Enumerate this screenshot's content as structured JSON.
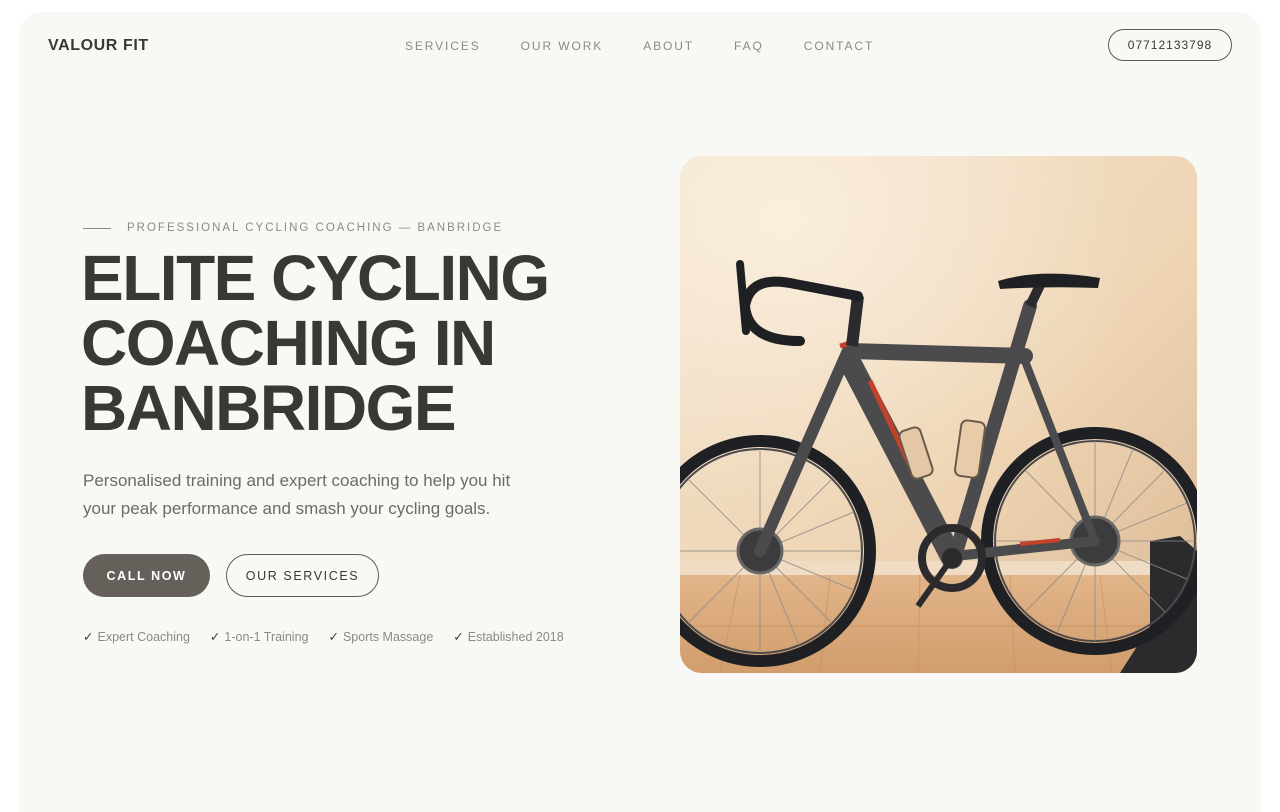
{
  "header": {
    "brand": "VALOUR FIT",
    "nav": [
      "SERVICES",
      "OUR WORK",
      "ABOUT",
      "FAQ",
      "CONTACT"
    ],
    "phone": "07712133798"
  },
  "hero": {
    "eyebrow": "PROFESSIONAL CYCLING COACHING — BANBRIDGE",
    "headline": [
      "ELITE CYCLING",
      "COACHING IN",
      "BANBRIDGE"
    ],
    "subtext": "Personalised training and expert coaching to help you hit your peak performance and smash your cycling goals.",
    "primary_cta": "CALL NOW",
    "secondary_cta": "OUR SERVICES",
    "features": [
      "Expert Coaching",
      "1-on-1 Training",
      "Sports Massage",
      "Established 2018"
    ],
    "check_icon": "checkmark-icon",
    "image": "road-bike-photo"
  },
  "colors": {
    "page_bg": "#f8f8f5",
    "text_dark": "#3a3833",
    "text_muted": "#8d8a84",
    "button_dark": "#65605a"
  }
}
